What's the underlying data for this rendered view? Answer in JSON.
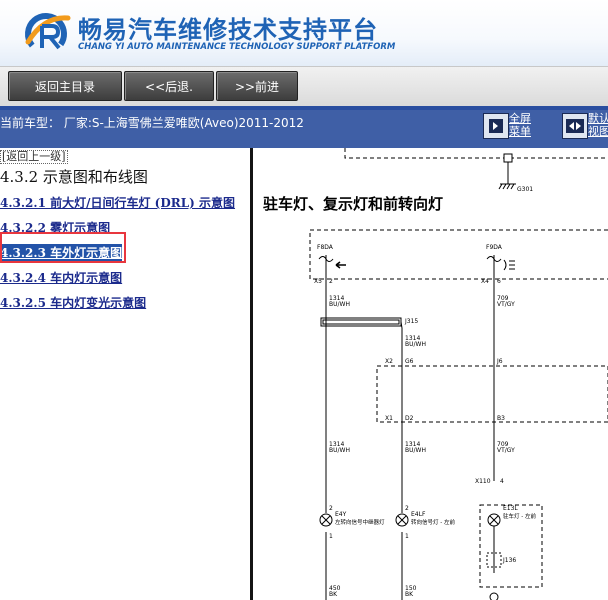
{
  "header": {
    "brand_cn": "畅易汽车维修技术支持平台",
    "brand_en": "CHANG YI AUTO MAINTENANCE TECHNOLOGY SUPPORT PLATFORM",
    "brand_color": "#1f63b5"
  },
  "toolbar": {
    "home_label": "返回主目录",
    "back_label": "<<后退.",
    "forward_label": ">>前进"
  },
  "infobar": {
    "vehicle": "当前车型： 厂家:S-上海雪佛兰爱唯欧(Aveo)2011-2012",
    "fullscreen_line1": "全屏",
    "fullscreen_line2": "菜单",
    "default_line1": "默认",
    "default_line2": "视图"
  },
  "nav": {
    "back_up": "[返回上一级]",
    "section": "4.3.2 示意图和布线图",
    "items": [
      {
        "label": "4.3.2.1 前大灯/日间行车灯 (DRL) 示意图",
        "active": false
      },
      {
        "label": "4.3.2.2 雾灯示意图",
        "active": false
      },
      {
        "label": "4.3.2.3 车外灯示意图",
        "active": true
      },
      {
        "label": "4.3.2.4 车内灯示意图",
        "active": false
      },
      {
        "label": "4.3.2.5 车内灯变光示意图",
        "active": false
      }
    ]
  },
  "diagram": {
    "title": "驻车灯、复示灯和前转向灯",
    "labels": {
      "g301": "G301",
      "f8da_left": "F8DA",
      "f8da_right": "F9DA",
      "x5": "X5",
      "x4": "X4",
      "pin2": "2",
      "pin6": "6",
      "w1314a": "1314",
      "w1314a_c": "BU/WH",
      "w709a": "709",
      "w709a_c": "VT/GY",
      "j315": "J315",
      "w1314b": "1314",
      "w1314b_c": "BU/WH",
      "x2": "X2",
      "g6": "G6",
      "j6": "J6",
      "x1": "X1",
      "d2": "D2",
      "b3": "B3",
      "w1314c": "1314",
      "w1314c_c": "BU/WH",
      "w1314d": "1314",
      "w1314d_c": "BU/WH",
      "w709b": "709",
      "w709b_c": "VT/GY",
      "x110": "X110",
      "x110_pin": "4",
      "lamp1_pin": "2",
      "lamp2_pin": "2",
      "lamp1_code": "E4Y",
      "lamp1_name": "左转向信号中继器灯",
      "lamp2_code": "E4LF",
      "lamp2_name": "转向信号灯 - 左前",
      "lamp3_code": "E13L",
      "lamp3_name": "驻车灯 - 左前",
      "pin1a": "1",
      "pin1b": "1",
      "j136": "J136",
      "w450": "450",
      "w450_c": "BK",
      "w150": "150",
      "w150_c": "BK"
    }
  }
}
